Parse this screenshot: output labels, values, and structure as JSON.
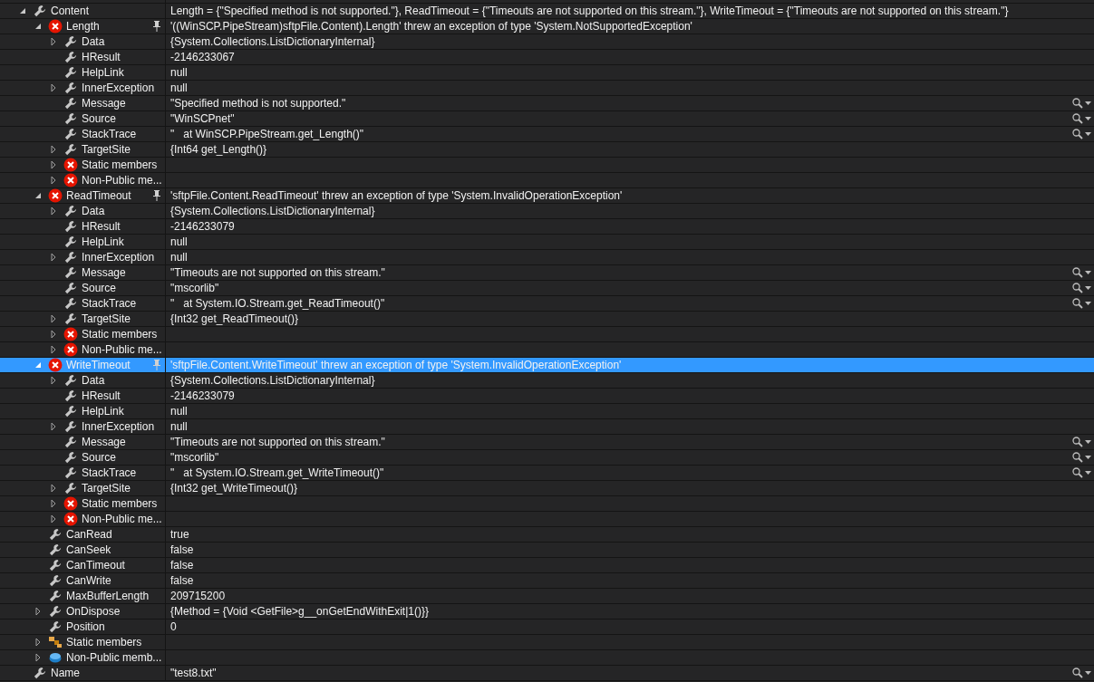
{
  "items": [
    {
      "name": "Content",
      "value": "Length = {\"Specified method is not supported.\"}, ReadTimeout = {\"Timeouts are not supported on this stream.\"}, WriteTimeout = {\"Timeouts are not supported on this stream.\"}",
      "kind": "property",
      "expanded": true,
      "selected": false,
      "children": [
        {
          "name": "Length",
          "value": "'((WinSCP.PipeStream)sftpFile.Content).Length' threw an exception of type 'System.NotSupportedException'",
          "kind": "error",
          "expanded": true,
          "pin": true,
          "selected": false,
          "children": [
            {
              "name": "Data",
              "value": "{System.Collections.ListDictionaryInternal}",
              "kind": "property",
              "expanded": false,
              "selected": false
            },
            {
              "name": "HResult",
              "value": "-2146233067",
              "kind": "property",
              "selected": false
            },
            {
              "name": "HelpLink",
              "value": "null",
              "kind": "property",
              "selected": false
            },
            {
              "name": "InnerException",
              "value": "null",
              "kind": "property",
              "expanded": false,
              "selected": false
            },
            {
              "name": "Message",
              "value": "\"Specified method is not supported.\"",
              "kind": "property",
              "visualizer": true,
              "selected": false
            },
            {
              "name": "Source",
              "value": "\"WinSCPnet\"",
              "kind": "property",
              "visualizer": true,
              "selected": false
            },
            {
              "name": "StackTrace",
              "value": "\"   at WinSCP.PipeStream.get_Length()\"",
              "kind": "property",
              "visualizer": true,
              "selected": false
            },
            {
              "name": "TargetSite",
              "value": "{Int64 get_Length()}",
              "kind": "property",
              "expanded": false,
              "selected": false
            },
            {
              "name": "Static members",
              "kind": "error",
              "expanded": false,
              "selected": false
            },
            {
              "name": "Non-Public me...",
              "kind": "error",
              "expanded": false,
              "selected": false
            }
          ]
        },
        {
          "name": "ReadTimeout",
          "value": "'sftpFile.Content.ReadTimeout' threw an exception of type 'System.InvalidOperationException'",
          "kind": "error",
          "expanded": true,
          "pin": true,
          "selected": false,
          "children": [
            {
              "name": "Data",
              "value": "{System.Collections.ListDictionaryInternal}",
              "kind": "property",
              "expanded": false,
              "selected": false
            },
            {
              "name": "HResult",
              "value": "-2146233079",
              "kind": "property",
              "selected": false
            },
            {
              "name": "HelpLink",
              "value": "null",
              "kind": "property",
              "selected": false
            },
            {
              "name": "InnerException",
              "value": "null",
              "kind": "property",
              "expanded": false,
              "selected": false
            },
            {
              "name": "Message",
              "value": "\"Timeouts are not supported on this stream.\"",
              "kind": "property",
              "visualizer": true,
              "selected": false
            },
            {
              "name": "Source",
              "value": "\"mscorlib\"",
              "kind": "property",
              "visualizer": true,
              "selected": false
            },
            {
              "name": "StackTrace",
              "value": "\"   at System.IO.Stream.get_ReadTimeout()\"",
              "kind": "property",
              "visualizer": true,
              "selected": false
            },
            {
              "name": "TargetSite",
              "value": "{Int32 get_ReadTimeout()}",
              "kind": "property",
              "expanded": false,
              "selected": false
            },
            {
              "name": "Static members",
              "kind": "error",
              "expanded": false,
              "selected": false
            },
            {
              "name": "Non-Public me...",
              "kind": "error",
              "expanded": false,
              "selected": false
            }
          ]
        },
        {
          "name": "WriteTimeout",
          "value": "'sftpFile.Content.WriteTimeout' threw an exception of type 'System.InvalidOperationException'",
          "kind": "error",
          "expanded": true,
          "pin": true,
          "selected": true,
          "children": [
            {
              "name": "Data",
              "value": "{System.Collections.ListDictionaryInternal}",
              "kind": "property",
              "expanded": false,
              "selected": false
            },
            {
              "name": "HResult",
              "value": "-2146233079",
              "kind": "property",
              "selected": false
            },
            {
              "name": "HelpLink",
              "value": "null",
              "kind": "property",
              "selected": false
            },
            {
              "name": "InnerException",
              "value": "null",
              "kind": "property",
              "expanded": false,
              "selected": false
            },
            {
              "name": "Message",
              "value": "\"Timeouts are not supported on this stream.\"",
              "kind": "property",
              "visualizer": true,
              "selected": false
            },
            {
              "name": "Source",
              "value": "\"mscorlib\"",
              "kind": "property",
              "visualizer": true,
              "selected": false
            },
            {
              "name": "StackTrace",
              "value": "\"   at System.IO.Stream.get_WriteTimeout()\"",
              "kind": "property",
              "visualizer": true,
              "selected": false
            },
            {
              "name": "TargetSite",
              "value": "{Int32 get_WriteTimeout()}",
              "kind": "property",
              "expanded": false,
              "selected": false
            },
            {
              "name": "Static members",
              "kind": "error",
              "expanded": false,
              "selected": false
            },
            {
              "name": "Non-Public me...",
              "kind": "error",
              "expanded": false,
              "selected": false
            }
          ]
        },
        {
          "name": "CanRead",
          "value": "true",
          "kind": "property",
          "selected": false
        },
        {
          "name": "CanSeek",
          "value": "false",
          "kind": "property",
          "selected": false
        },
        {
          "name": "CanTimeout",
          "value": "false",
          "kind": "property",
          "selected": false
        },
        {
          "name": "CanWrite",
          "value": "false",
          "kind": "property",
          "selected": false
        },
        {
          "name": "MaxBufferLength",
          "value": "209715200",
          "kind": "property",
          "selected": false
        },
        {
          "name": "OnDispose",
          "value": "{Method = {Void <GetFile>g__onGetEndWithExit|1()}}",
          "kind": "property",
          "expanded": false,
          "selected": false
        },
        {
          "name": "Position",
          "value": "0",
          "kind": "property",
          "selected": false
        },
        {
          "name": "Static members",
          "kind": "static",
          "expanded": false,
          "selected": false
        },
        {
          "name": "Non-Public memb...",
          "kind": "nonpublic",
          "expanded": false,
          "selected": false
        }
      ]
    },
    {
      "name": "Name",
      "value": "\"test8.txt\"",
      "kind": "property",
      "visualizer": true,
      "selected": false
    }
  ]
}
